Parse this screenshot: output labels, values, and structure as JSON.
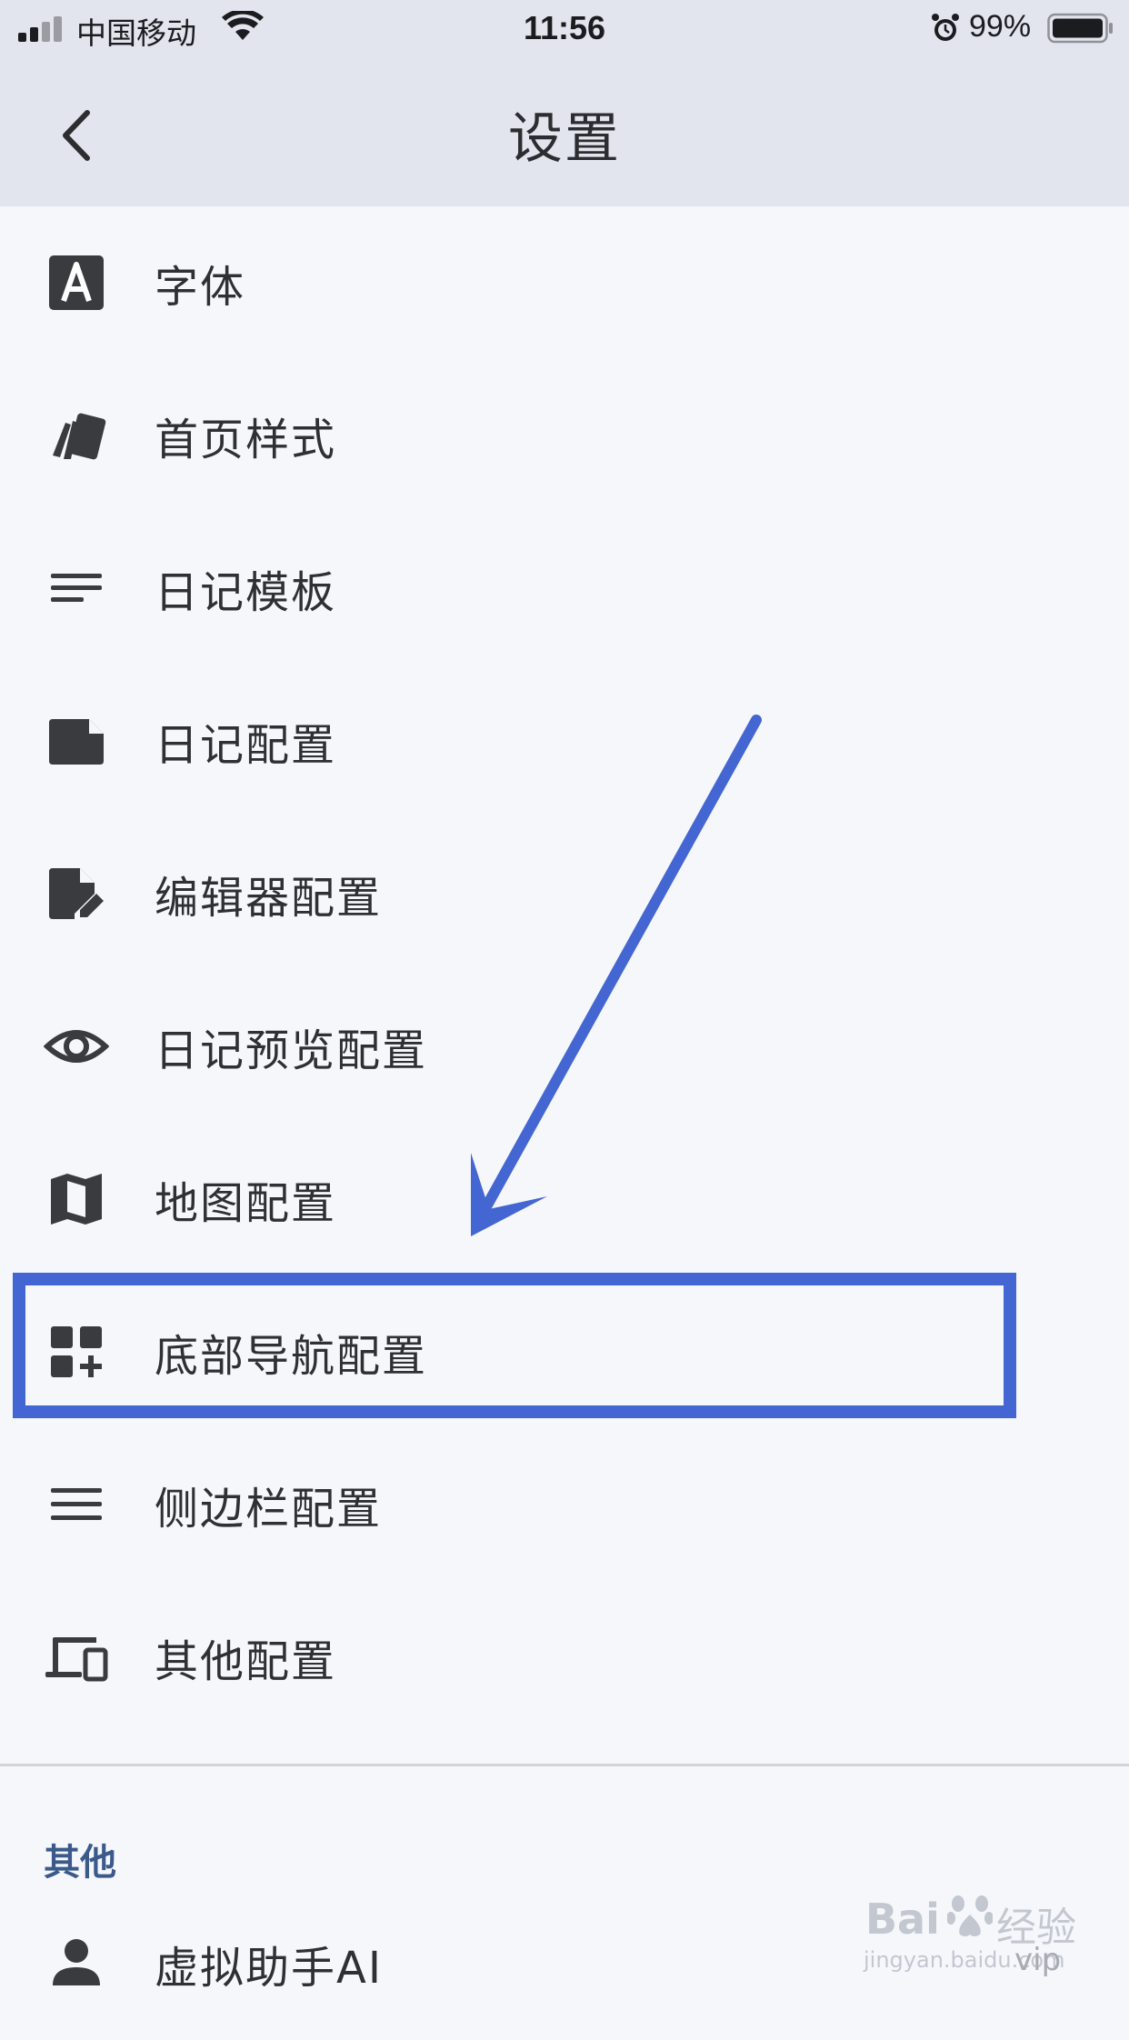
{
  "status_bar": {
    "carrier": "中国移动",
    "time": "11:56",
    "battery_percent": "99%",
    "icons": [
      "signal-icon",
      "wifi-icon",
      "alarm-icon",
      "battery-icon"
    ]
  },
  "nav": {
    "title": "设置",
    "back_icon": "chevron-left-icon"
  },
  "settings_items": [
    {
      "label": "字体",
      "icon": "font-icon"
    },
    {
      "label": "首页样式",
      "icon": "cards-icon"
    },
    {
      "label": "日记模板",
      "icon": "lines-icon"
    },
    {
      "label": "日记配置",
      "icon": "note-icon"
    },
    {
      "label": "编辑器配置",
      "icon": "file-edit-icon"
    },
    {
      "label": "日记预览配置",
      "icon": "eye-icon"
    },
    {
      "label": "地图配置",
      "icon": "map-icon"
    },
    {
      "label": "底部导航配置",
      "icon": "grid-add-icon",
      "highlighted": true
    },
    {
      "label": "侧边栏配置",
      "icon": "menu-icon"
    },
    {
      "label": "其他配置",
      "icon": "devices-icon"
    }
  ],
  "other_section": {
    "header": "其他",
    "items": [
      {
        "label": "虚拟助手AI",
        "icon": "person-icon"
      }
    ]
  },
  "watermark": {
    "brand": "Bai",
    "brand_suffix": "经验",
    "url": "jingyan.baidu.com",
    "badge": "vip"
  },
  "colors": {
    "accent": "#4466d2",
    "header_bg": "#e2e5ed",
    "page_bg": "#f5f7fb",
    "section_header": "#3b5a8a",
    "icon": "#3a3b3f"
  }
}
